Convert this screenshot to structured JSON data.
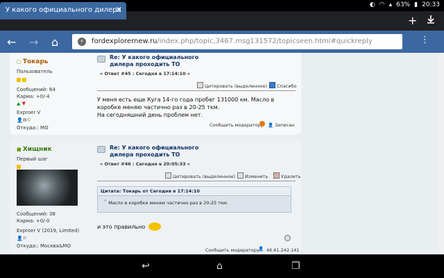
{
  "status": {
    "battery": "63%",
    "time": "20:33"
  },
  "tab": {
    "title": "У какого официального дилера",
    "close": "✕"
  },
  "url": {
    "host": "fordexplorernew.ru",
    "path": "/index.php/topic,3467.msg131572/topicseen.html#quickreply"
  },
  "posts": [
    {
      "author": "Токарь",
      "rank": "Пользователь",
      "messages": "Сообщений: 64",
      "karma": "Карма: +0/-4",
      "car": "Exproer V",
      "from": "Откуда:: МО",
      "subject": "Re: У какого официального дилера проходить ТО",
      "meta_num": "« Ответ #45 :",
      "meta_date": "Сегодня в 17:14:10",
      "meta_end": "»",
      "cite_label": "Цитировать (выделенное)",
      "thanks_label": "Спасибо",
      "body": [
        "У меня есть еще Куга 14-го года пробег 131000 км. Масло в коробке меняю частично раз в 20-25 ткм.",
        "На сегодняшний день проблем нет."
      ],
      "report": "Сообщить модератору",
      "logged": "Записан"
    },
    {
      "author": "Хищник",
      "rank": "Первый шаг",
      "messages": "Сообщений: 38",
      "karma": "Карма: +0/-0",
      "car": "Exproer V (2019, Limited)",
      "from": "Откуда:: Москва&МО",
      "subject": "Re: У какого официального дилера проходить ТО",
      "meta_num": "« Ответ #46 :",
      "meta_date": "Сегодня в 20:05:33",
      "meta_end": "»",
      "cite_label": "Цитировать (выделенное)",
      "edit_label": "Изменить",
      "delete_label": "Удалить",
      "quote_head": "Цитата: Токарь от Сегодня в 17:14:10",
      "quote_body": "Масло в коробке меняю частично раз в 20-25 ткм.",
      "body": "и это правильно",
      "report": "Сообщить модератору",
      "ip": "46.61.242.141"
    }
  ],
  "colors": {
    "chrome": "#3b68a0",
    "page": "#e9eef1",
    "post": "#f6f8f9",
    "author": "#ad5a00"
  }
}
